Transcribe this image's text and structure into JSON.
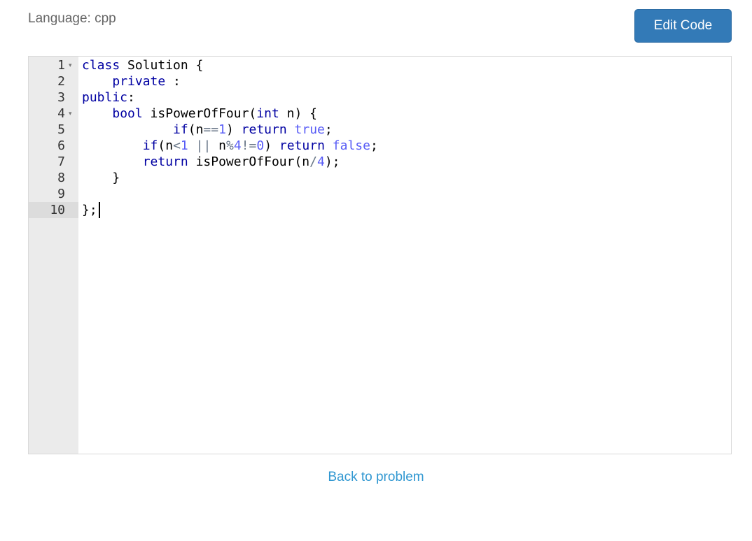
{
  "header": {
    "language_label": "Language: cpp",
    "edit_button_label": "Edit Code"
  },
  "editor": {
    "line_numbers": [
      "1",
      "2",
      "3",
      "4",
      "5",
      "6",
      "7",
      "8",
      "9",
      "10"
    ],
    "folded_lines": [
      1,
      4
    ],
    "active_line": 10,
    "lines": [
      [
        {
          "t": "class",
          "c": "kw"
        },
        {
          "t": " Solution {",
          "c": ""
        }
      ],
      [
        {
          "t": "    ",
          "c": ""
        },
        {
          "t": "private",
          "c": "kw"
        },
        {
          "t": " :",
          "c": ""
        }
      ],
      [
        {
          "t": "public",
          "c": "kw"
        },
        {
          "t": ":",
          "c": ""
        }
      ],
      [
        {
          "t": "    ",
          "c": ""
        },
        {
          "t": "bool",
          "c": "ty"
        },
        {
          "t": " isPowerOfFour(",
          "c": ""
        },
        {
          "t": "int",
          "c": "ty"
        },
        {
          "t": " n) {",
          "c": ""
        }
      ],
      [
        {
          "t": "            ",
          "c": ""
        },
        {
          "t": "if",
          "c": "kw"
        },
        {
          "t": "(n",
          "c": ""
        },
        {
          "t": "==",
          "c": "op"
        },
        {
          "t": "1",
          "c": "lit"
        },
        {
          "t": ") ",
          "c": ""
        },
        {
          "t": "return",
          "c": "kw"
        },
        {
          "t": " ",
          "c": ""
        },
        {
          "t": "true",
          "c": "lit"
        },
        {
          "t": ";",
          "c": ""
        }
      ],
      [
        {
          "t": "        ",
          "c": ""
        },
        {
          "t": "if",
          "c": "kw"
        },
        {
          "t": "(n",
          "c": ""
        },
        {
          "t": "<",
          "c": "op"
        },
        {
          "t": "1",
          "c": "lit"
        },
        {
          "t": " ",
          "c": ""
        },
        {
          "t": "||",
          "c": "op"
        },
        {
          "t": " n",
          "c": ""
        },
        {
          "t": "%",
          "c": "op"
        },
        {
          "t": "4",
          "c": "lit"
        },
        {
          "t": "!=",
          "c": "op"
        },
        {
          "t": "0",
          "c": "lit"
        },
        {
          "t": ") ",
          "c": ""
        },
        {
          "t": "return",
          "c": "kw"
        },
        {
          "t": " ",
          "c": ""
        },
        {
          "t": "false",
          "c": "lit"
        },
        {
          "t": ";",
          "c": ""
        }
      ],
      [
        {
          "t": "        ",
          "c": ""
        },
        {
          "t": "return",
          "c": "kw"
        },
        {
          "t": " isPowerOfFour(n",
          "c": ""
        },
        {
          "t": "/",
          "c": "op"
        },
        {
          "t": "4",
          "c": "lit"
        },
        {
          "t": ");",
          "c": ""
        }
      ],
      [
        {
          "t": "    }",
          "c": ""
        }
      ],
      [],
      [
        {
          "t": "};",
          "c": ""
        }
      ]
    ]
  },
  "footer": {
    "back_link_label": "Back to problem"
  },
  "colors": {
    "button_bg": "#337ab7",
    "link": "#3097d1",
    "keyword": "#0000a2",
    "literal": "#585cf6",
    "gutter_bg": "#ebebeb"
  }
}
